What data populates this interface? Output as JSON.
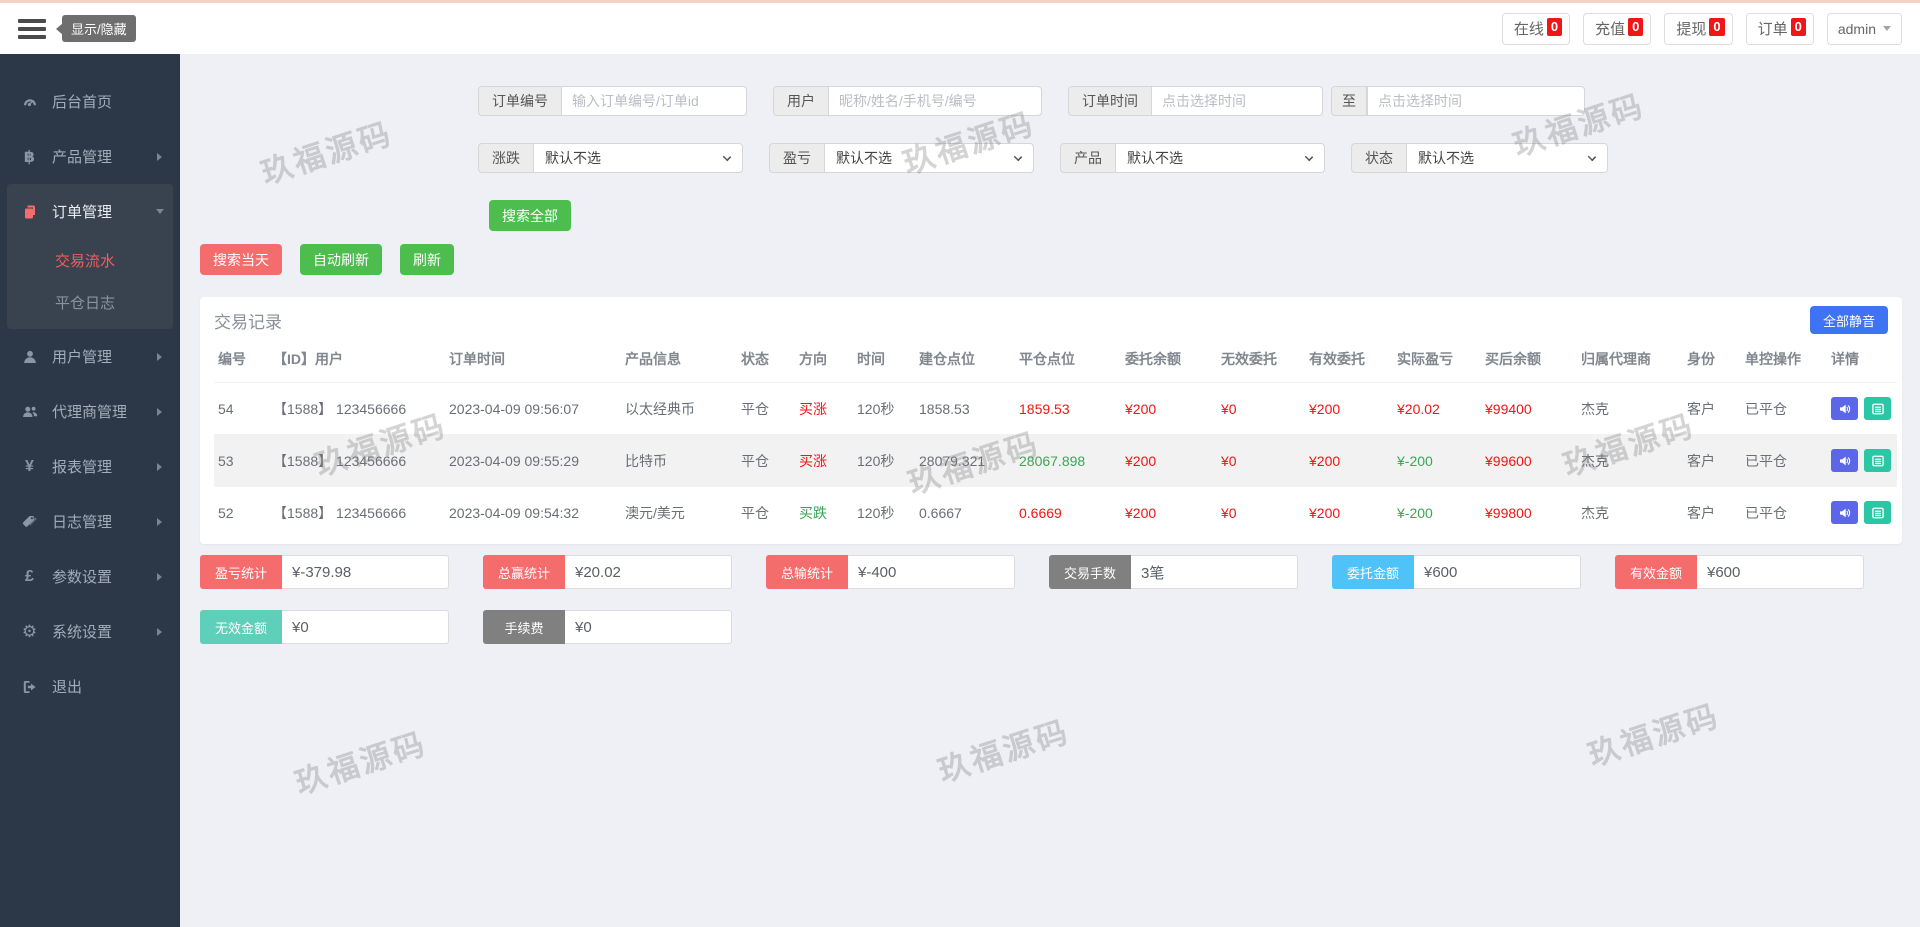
{
  "topbar": {
    "toggle_tooltip": "显示/隐藏",
    "badges": [
      {
        "label": "在线",
        "count": "0"
      },
      {
        "label": "充值",
        "count": "0"
      },
      {
        "label": "提现",
        "count": "0"
      },
      {
        "label": "订单",
        "count": "0"
      }
    ],
    "user": {
      "name": "admin"
    }
  },
  "sidebar": {
    "items": [
      {
        "id": "dashboard",
        "icon": "gauge-icon",
        "label": "后台首页"
      },
      {
        "id": "products",
        "icon": "bitcoin-icon",
        "label": "产品管理",
        "arrow": "right"
      },
      {
        "id": "orders",
        "icon": "orders-icon",
        "label": "订单管理",
        "arrow": "down",
        "active": true,
        "children": [
          {
            "label": "交易流水",
            "active": true
          },
          {
            "label": "平仓日志",
            "active": false
          }
        ]
      },
      {
        "id": "users",
        "icon": "user-icon",
        "label": "用户管理",
        "arrow": "right"
      },
      {
        "id": "agents",
        "icon": "users-icon",
        "label": "代理商管理",
        "arrow": "right"
      },
      {
        "id": "reports",
        "icon": "yen-icon",
        "label": "报表管理",
        "arrow": "right"
      },
      {
        "id": "logs",
        "icon": "tags-icon",
        "label": "日志管理",
        "arrow": "right"
      },
      {
        "id": "params",
        "icon": "pound-icon",
        "label": "参数设置",
        "arrow": "right"
      },
      {
        "id": "system",
        "icon": "gear-icon",
        "label": "系统设置",
        "arrow": "right"
      },
      {
        "id": "logout",
        "icon": "logout-icon",
        "label": "退出"
      }
    ]
  },
  "filters": {
    "order_no": {
      "label": "订单编号",
      "placeholder": "输入订单编号/订单id"
    },
    "user": {
      "label": "用户",
      "placeholder": "昵称/姓名/手机号/编号"
    },
    "order_time": {
      "label": "订单时间",
      "placeholder": "点击选择时间",
      "to_label": "至",
      "placeholder2": "点击选择时间"
    },
    "rise_fall": {
      "label": "涨跌",
      "value": "默认不选"
    },
    "profit_loss": {
      "label": "盈亏",
      "value": "默认不选"
    },
    "product": {
      "label": "产品",
      "value": "默认不选"
    },
    "status": {
      "label": "状态",
      "value": "默认不选"
    },
    "search_all": "搜索全部"
  },
  "toolbar": {
    "search_today": "搜索当天",
    "auto_refresh": "自动刷新",
    "refresh": "刷新"
  },
  "panel": {
    "title": "交易记录",
    "mute_all": "全部静音"
  },
  "table": {
    "headers": [
      "编号",
      "【ID】用户",
      "订单时间",
      "产品信息",
      "状态",
      "方向",
      "时间",
      "建仓点位",
      "平仓点位",
      "委托余额",
      "无效委托",
      "有效委托",
      "实际盈亏",
      "买后余额",
      "归属代理商",
      "身份",
      "单控操作",
      "详情"
    ],
    "rows": [
      {
        "cells": [
          {
            "t": "54"
          },
          {
            "t": "【1588】 123456666"
          },
          {
            "t": "2023-04-09 09:56:07"
          },
          {
            "t": "以太经典币"
          },
          {
            "t": "平仓"
          },
          {
            "t": "买涨",
            "c": "red"
          },
          {
            "t": "120秒"
          },
          {
            "t": "1858.53"
          },
          {
            "t": "1859.53",
            "c": "red"
          },
          {
            "t": "¥200",
            "c": "red"
          },
          {
            "t": "¥0",
            "c": "red"
          },
          {
            "t": "¥200",
            "c": "red"
          },
          {
            "t": "¥20.02",
            "c": "red"
          },
          {
            "t": "¥99400",
            "c": "red"
          },
          {
            "t": "杰克"
          },
          {
            "t": "客户"
          },
          {
            "t": "已平仓"
          }
        ]
      },
      {
        "cells": [
          {
            "t": "53"
          },
          {
            "t": "【1588】 123456666"
          },
          {
            "t": "2023-04-09 09:55:29"
          },
          {
            "t": "比特币"
          },
          {
            "t": "平仓"
          },
          {
            "t": "买涨",
            "c": "red"
          },
          {
            "t": "120秒"
          },
          {
            "t": "28079.321"
          },
          {
            "t": "28067.898",
            "c": "green"
          },
          {
            "t": "¥200",
            "c": "red"
          },
          {
            "t": "¥0",
            "c": "red"
          },
          {
            "t": "¥200",
            "c": "red"
          },
          {
            "t": "¥-200",
            "c": "green"
          },
          {
            "t": "¥99600",
            "c": "red"
          },
          {
            "t": "杰克"
          },
          {
            "t": "客户"
          },
          {
            "t": "已平仓"
          }
        ]
      },
      {
        "cells": [
          {
            "t": "52"
          },
          {
            "t": "【1588】 123456666"
          },
          {
            "t": "2023-04-09 09:54:32"
          },
          {
            "t": "澳元/美元"
          },
          {
            "t": "平仓"
          },
          {
            "t": "买跌",
            "c": "green"
          },
          {
            "t": "120秒"
          },
          {
            "t": "0.6667"
          },
          {
            "t": "0.6669",
            "c": "red"
          },
          {
            "t": "¥200",
            "c": "red"
          },
          {
            "t": "¥0",
            "c": "red"
          },
          {
            "t": "¥200",
            "c": "red"
          },
          {
            "t": "¥-200",
            "c": "green"
          },
          {
            "t": "¥99800",
            "c": "red"
          },
          {
            "t": "杰克"
          },
          {
            "t": "客户"
          },
          {
            "t": "已平仓"
          }
        ]
      }
    ]
  },
  "summary": [
    {
      "label": "盈亏统计",
      "value": "¥-379.98",
      "color": "#f56c6c"
    },
    {
      "label": "总赢统计",
      "value": "¥20.02",
      "color": "#f56c6c"
    },
    {
      "label": "总输统计",
      "value": "¥-400",
      "color": "#f56c6c"
    },
    {
      "label": "交易手数",
      "value": "3笔",
      "color": "#808080"
    },
    {
      "label": "委托金额",
      "value": "¥600",
      "color": "#4fc3f7"
    },
    {
      "label": "有效金额",
      "value": "¥600",
      "color": "#f56c6c"
    },
    {
      "label": "无效金额",
      "value": "¥0",
      "color": "#5ecfb8"
    },
    {
      "label": "手续费",
      "value": "¥0",
      "color": "#808080"
    }
  ],
  "watermark": {
    "text": "玖福源码"
  },
  "colors": {
    "up_red": "#f21414",
    "down_green": "#3aa655",
    "accent_blue": "#3e73f4",
    "badge_red": "#f01616"
  }
}
